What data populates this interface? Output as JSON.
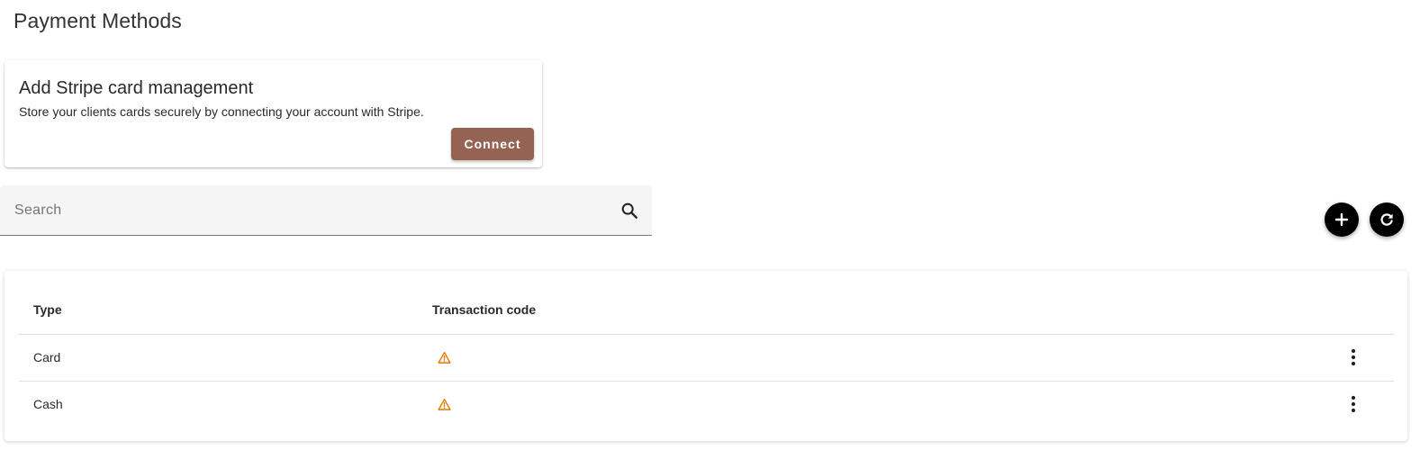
{
  "page": {
    "title": "Payment Methods"
  },
  "stripe_card": {
    "title": "Add Stripe card management",
    "description": "Store your clients cards securely by connecting your account with Stripe.",
    "connect_label": "Connect"
  },
  "search": {
    "placeholder": "Search",
    "value": ""
  },
  "toolbar": {
    "add_icon": "plus-icon",
    "refresh_icon": "refresh-icon"
  },
  "table": {
    "columns": [
      "Type",
      "Transaction code"
    ],
    "rows": [
      {
        "type": "Card",
        "transaction_code_icon": "warning-icon"
      },
      {
        "type": "Cash",
        "transaction_code_icon": "warning-icon"
      }
    ]
  },
  "colors": {
    "accent": "#956353",
    "warning": "#e07b00",
    "fab": "#000000"
  }
}
